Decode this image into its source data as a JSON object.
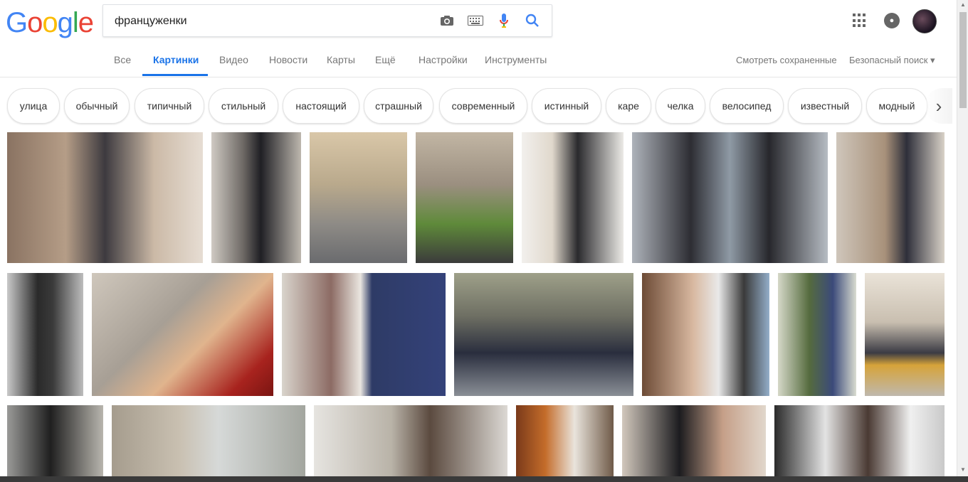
{
  "logo": {
    "letters": [
      "G",
      "o",
      "o",
      "g",
      "l",
      "e"
    ],
    "colors": [
      "#4285f4",
      "#ea4335",
      "#fbbc05",
      "#4285f4",
      "#34a853",
      "#ea4335"
    ]
  },
  "search": {
    "query": "француженки",
    "icons": [
      "camera-icon",
      "keyboard-icon",
      "mic-icon",
      "search-icon"
    ]
  },
  "nav": {
    "tabs": [
      "Все",
      "Картинки",
      "Видео",
      "Новости",
      "Карты",
      "Ещё",
      "Настройки",
      "Инструменты"
    ],
    "active": "Картинки",
    "saved": "Смотреть сохраненные",
    "safe_search": "Безопасный поиск ▾"
  },
  "header_icons": [
    "apps-grid-icon",
    "notifications-icon",
    "account-avatar"
  ],
  "chips": [
    "улица",
    "обычный",
    "типичный",
    "стильный",
    "настоящий",
    "страшный",
    "современный",
    "истинный",
    "каре",
    "челка",
    "велосипед",
    "известный",
    "модный"
  ],
  "chip_next": "›",
  "colors": {
    "accent": "#1a73e8",
    "nav_text": "#777777"
  }
}
